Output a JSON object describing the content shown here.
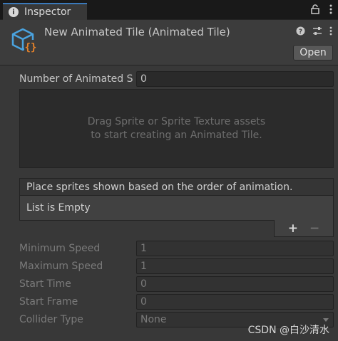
{
  "tab": {
    "label": "Inspector",
    "info_icon": "i"
  },
  "header": {
    "title": "New Animated Tile (Animated Tile)",
    "open_label": "Open"
  },
  "fields": {
    "number_label": "Number of Animated S",
    "number_value": "0"
  },
  "drop_area": {
    "line1": "Drag Sprite or Sprite Texture assets",
    "line2": "to start creating an Animated Tile."
  },
  "list": {
    "header": "Place sprites shown based on the order of animation.",
    "empty": "List is Empty",
    "plus": "+",
    "minus": "−"
  },
  "settings": [
    {
      "label": "Minimum Speed",
      "value": "1"
    },
    {
      "label": "Maximum Speed",
      "value": "1"
    },
    {
      "label": "Start Time",
      "value": "0"
    },
    {
      "label": "Start Frame",
      "value": "0"
    },
    {
      "label": "Collider Type",
      "value": "None"
    }
  ],
  "watermark": "CSDN @白沙清水",
  "icons": {
    "lock": "lock-icon",
    "menu": "kebab-menu-icon",
    "help": "help-icon",
    "preset": "preset-icon"
  },
  "colors": {
    "accent": "#3a79bb",
    "asset_orange": "#e8832a",
    "asset_blue": "#4aa3df"
  }
}
